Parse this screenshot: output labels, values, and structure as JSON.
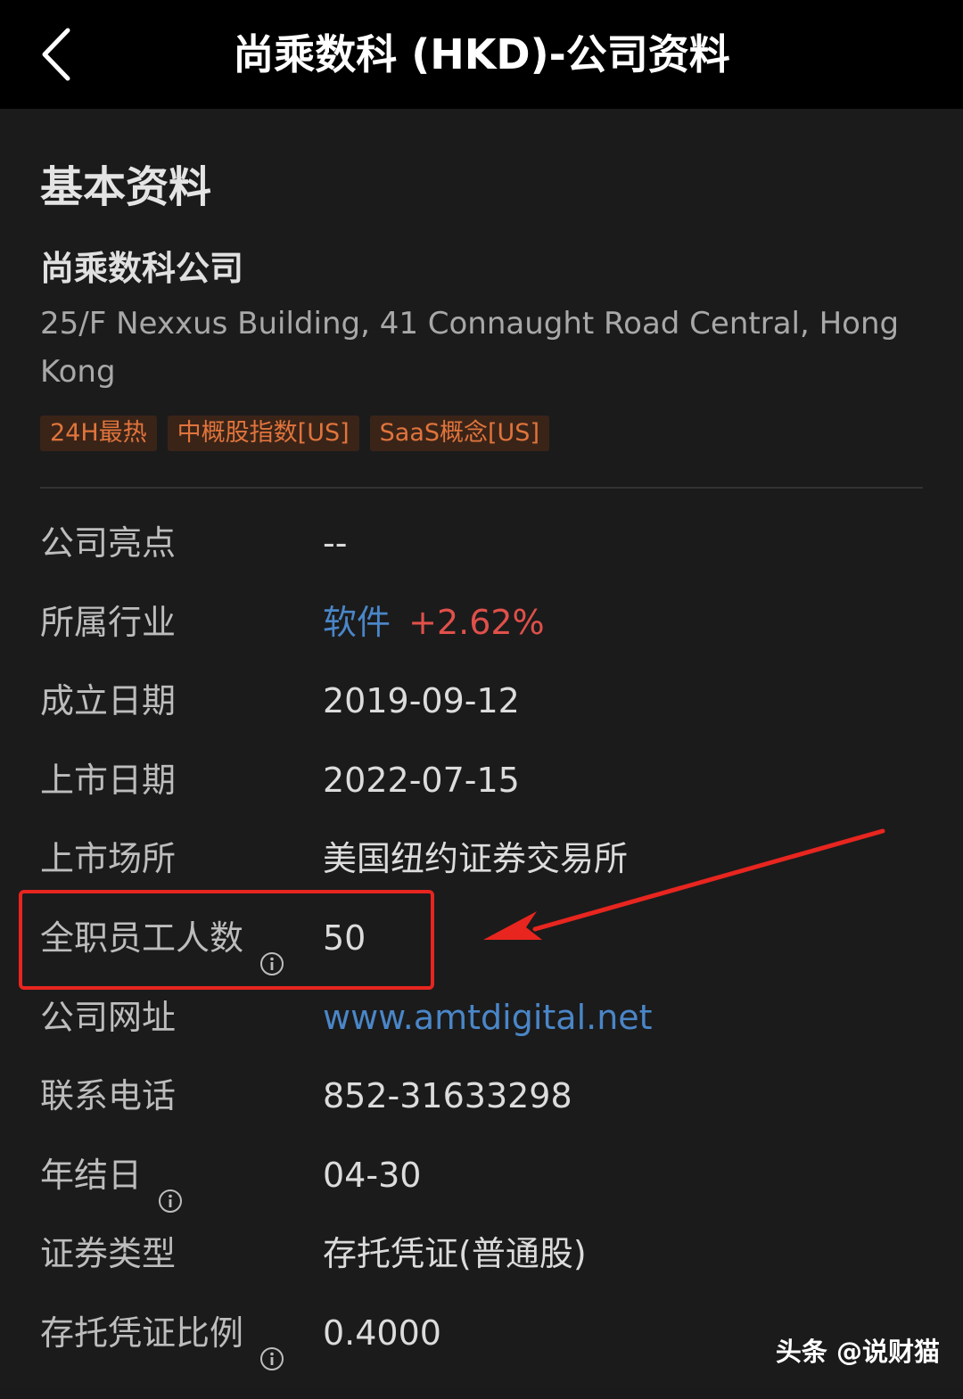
{
  "nav": {
    "title": "尚乘数科 (HKD)-公司资料"
  },
  "section": {
    "title": "基本资料"
  },
  "company": {
    "name": "尚乘数科公司",
    "address": "25/F Nexxus Building, 41 Connaught Road Central, Hong Kong"
  },
  "tags": [
    "24H最热",
    "中概股指数[US]",
    "SaaS概念[US]"
  ],
  "rows": {
    "highlights": {
      "label": "公司亮点",
      "value": "--"
    },
    "industry": {
      "label": "所属行业",
      "value_name": "软件",
      "value_change": "+2.62%"
    },
    "founded": {
      "label": "成立日期",
      "value": "2019-09-12"
    },
    "listed": {
      "label": "上市日期",
      "value": "2022-07-15"
    },
    "exchange": {
      "label": "上市场所",
      "value": "美国纽约证券交易所"
    },
    "employees": {
      "label": "全职员工人数",
      "value": "50"
    },
    "website": {
      "label": "公司网址",
      "value": "www.amtdigital.net"
    },
    "phone": {
      "label": "联系电话",
      "value": "852-31633298"
    },
    "fiscal_year_end": {
      "label": "年结日",
      "value": "04-30"
    },
    "security_type": {
      "label": "证券类型",
      "value": "存托凭证(普通股)"
    },
    "adr_ratio": {
      "label": "存托凭证比例",
      "value": "0.4000"
    }
  },
  "watermark": "头条 @说财猫",
  "colors": {
    "background": "#1b1b1b",
    "nav_background": "#000000",
    "link_blue": "#4a86c8",
    "change_red": "#e0504a",
    "tag_orange": "#e0743c",
    "highlight_red": "#e8251f"
  }
}
